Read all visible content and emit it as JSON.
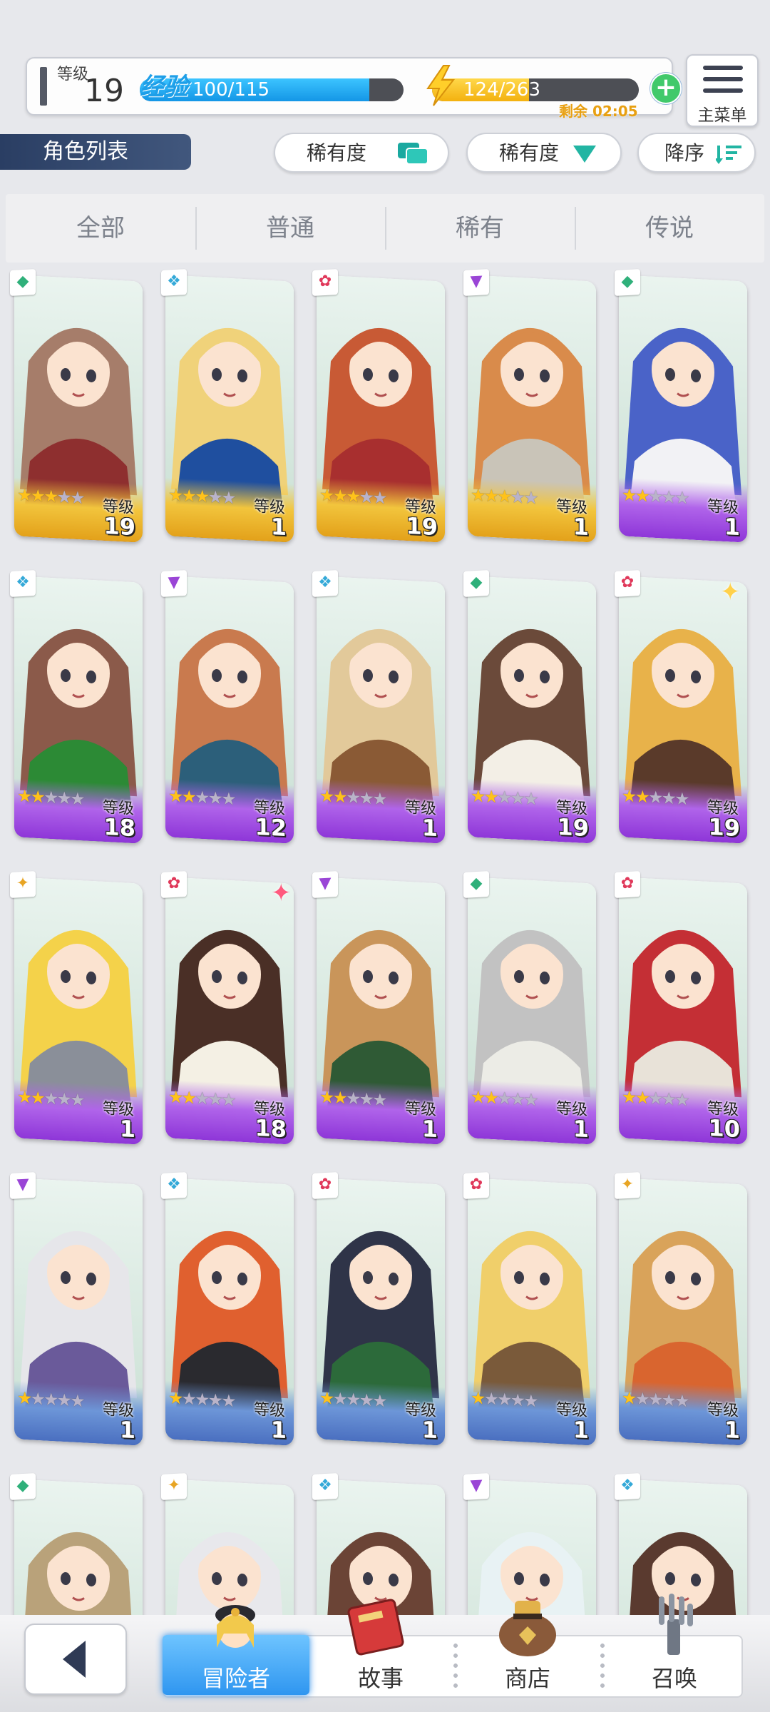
{
  "header": {
    "level_label": "等级",
    "level_value": "19",
    "exp_label": "经验",
    "exp_text": "100/115",
    "exp_fraction": 0.87,
    "stamina_text": "124/263",
    "stamina_fraction": 0.47,
    "stamina_remaining": "剩余 02:05",
    "menu_label": "主菜单"
  },
  "list_title": "角色列表",
  "filters": {
    "rarity_filter_label": "稀有度",
    "rarity_sort_label": "稀有度",
    "order_label": "降序"
  },
  "tabs": [
    "全部",
    "普通",
    "稀有",
    "传说"
  ],
  "active_tab": 0,
  "card_level_label": "等级",
  "characters": [
    {
      "level": "19",
      "element": "wind",
      "stars": 3,
      "frame": "gold",
      "hair": "#a67d6a",
      "outfit": "#8e2f2f"
    },
    {
      "level": "1",
      "element": "water",
      "stars": 3,
      "frame": "gold",
      "hair": "#f0d27a",
      "outfit": "#1f4f9f"
    },
    {
      "level": "19",
      "element": "fire",
      "stars": 3,
      "frame": "gold",
      "hair": "#c85a35",
      "outfit": "#a82f2f"
    },
    {
      "level": "1",
      "element": "dark",
      "stars": 3,
      "frame": "gold",
      "hair": "#d98b4b",
      "outfit": "#c9c4b8"
    },
    {
      "level": "1",
      "element": "wind",
      "stars": 2,
      "frame": "purple",
      "hair": "#4a63c8",
      "outfit": "#f2f2f5"
    },
    {
      "level": "18",
      "element": "water",
      "stars": 2,
      "frame": "purple",
      "hair": "#8b5a4a",
      "outfit": "#2c8a35"
    },
    {
      "level": "12",
      "element": "dark",
      "stars": 2,
      "frame": "purple",
      "hair": "#c97a4e",
      "outfit": "#2c5f7a"
    },
    {
      "level": "1",
      "element": "water",
      "stars": 2,
      "frame": "purple",
      "hair": "#e2c99a",
      "outfit": "#8a5a35"
    },
    {
      "level": "19",
      "element": "wind",
      "stars": 2,
      "frame": "purple",
      "hair": "#6b4a3a",
      "outfit": "#f3efe6"
    },
    {
      "level": "19",
      "element": "fire",
      "stars": 2,
      "frame": "purple",
      "hair": "#e8b24a",
      "outfit": "#5a3a2a"
    },
    {
      "level": "1",
      "element": "light",
      "stars": 2,
      "frame": "purple",
      "hair": "#f4d24a",
      "outfit": "#8a8f99"
    },
    {
      "level": "18",
      "element": "fire",
      "stars": 2,
      "frame": "purple",
      "hair": "#4a2f26",
      "outfit": "#f4f0e4"
    },
    {
      "level": "1",
      "element": "dark",
      "stars": 2,
      "frame": "purple",
      "hair": "#c9955a",
      "outfit": "#2f5a35"
    },
    {
      "level": "1",
      "element": "wind",
      "stars": 2,
      "frame": "purple",
      "hair": "#c2c2c2",
      "outfit": "#ecece6"
    },
    {
      "level": "10",
      "element": "fire",
      "stars": 2,
      "frame": "purple",
      "hair": "#c42f35",
      "outfit": "#e8e2d8"
    },
    {
      "level": "1",
      "element": "dark",
      "stars": 1,
      "frame": "blue",
      "hair": "#e6e6ea",
      "outfit": "#6a5a9a"
    },
    {
      "level": "1",
      "element": "water",
      "stars": 1,
      "frame": "blue",
      "hair": "#e0602f",
      "outfit": "#2a2a2f"
    },
    {
      "level": "1",
      "element": "fire",
      "stars": 1,
      "frame": "blue",
      "hair": "#2f3448",
      "outfit": "#2c6a3a"
    },
    {
      "level": "1",
      "element": "fire",
      "stars": 1,
      "frame": "blue",
      "hair": "#f0cf6a",
      "outfit": "#7a5a3a"
    },
    {
      "level": "1",
      "element": "light",
      "stars": 1,
      "frame": "blue",
      "hair": "#d9a35a",
      "outfit": "#d9652f"
    },
    {
      "level": "",
      "element": "wind",
      "stars": 1,
      "frame": "blue",
      "hair": "#b9a27a",
      "outfit": "#4a5a35"
    },
    {
      "level": "",
      "element": "light",
      "stars": 1,
      "frame": "blue",
      "hair": "#e8e8ec",
      "outfit": "#dcdce2"
    },
    {
      "level": "",
      "element": "water",
      "stars": 1,
      "frame": "blue",
      "hair": "#6b4436",
      "outfit": "#c98a6a"
    },
    {
      "level": "",
      "element": "dark",
      "stars": 1,
      "frame": "blue",
      "hair": "#e8f2f4",
      "outfit": "#6ab46a"
    },
    {
      "level": "",
      "element": "water",
      "stars": 1,
      "frame": "blue",
      "hair": "#5a3a2f",
      "outfit": "#2f5a4a"
    }
  ],
  "element_colors": {
    "wind": "#2fb07a",
    "water": "#34a9d8",
    "fire": "#e0385a",
    "dark": "#9a45d6",
    "light": "#e8a524"
  },
  "nav": {
    "back_icon": "back-arrow-icon",
    "items": [
      "冒险者",
      "故事",
      "商店",
      "召唤"
    ],
    "active": 0
  }
}
